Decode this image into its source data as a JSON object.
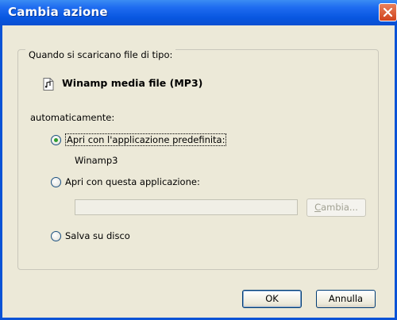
{
  "window": {
    "title": "Cambia azione"
  },
  "group": {
    "legend": "Quando si scaricano file di tipo:"
  },
  "file_type": {
    "label": "Winamp media file (MP3)"
  },
  "auto_label": "automaticamente:",
  "options": [
    {
      "label": "Apri con l'applicazione predefinita:",
      "checked": true
    },
    {
      "label": "Apri con questa applicazione:",
      "checked": false
    },
    {
      "label": "Salva su disco",
      "checked": false
    }
  ],
  "default_app": "Winamp3",
  "app_input": {
    "value": ""
  },
  "buttons": {
    "change_first": "C",
    "change_rest": "ambia...",
    "ok": "OK",
    "cancel": "Annulla"
  },
  "colors": {
    "titlebar": "#0a53d6",
    "dialog_bg": "#ece9d8",
    "radio_dot": "#2c9c2c",
    "close_button": "#d0431d"
  }
}
